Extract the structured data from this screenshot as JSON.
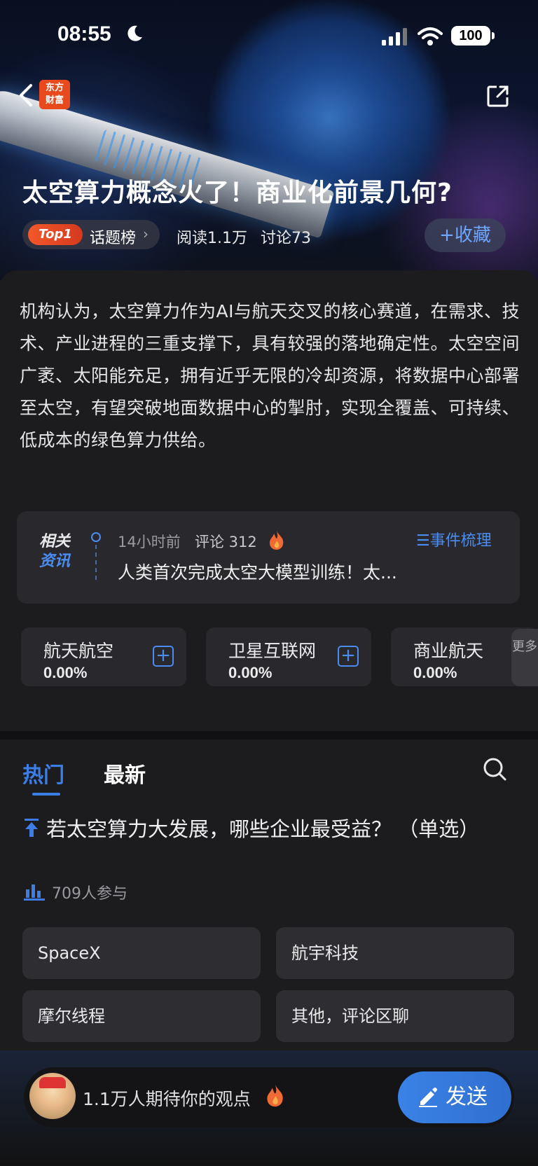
{
  "status_bar": {
    "time": "08:55",
    "battery": "100"
  },
  "nav": {
    "logo_line1": "东方",
    "logo_line2": "财富"
  },
  "topic": {
    "title": "太空算力概念火了！商业化前景几何?",
    "rank_badge": "Top1",
    "rank_label": "话题榜",
    "reads": "阅读1.1万",
    "discussions": "讨论73",
    "collect_label": "+收藏"
  },
  "summary": "机构认为，太空算力作为AI与航天交叉的核心赛道，在需求、技术、产业进程的三重支撑下，具有较强的落地确定性。太空空间广袤、太阳能充足，拥有近乎无限的冷却资源，将数据中心部署至太空，有望突破地面数据中心的掣肘，实现全覆盖、可持续、低成本的绿色算力供给。",
  "related_news": {
    "badge_line1": "相关",
    "badge_line2": "资讯",
    "time": "14小时前",
    "comments": "评论 312",
    "events_link": "☰事件梳理",
    "headline": "人类首次完成太空大模型训练！太..."
  },
  "sectors": [
    {
      "name": "航天航空",
      "value": "0.00%"
    },
    {
      "name": "卫星互联网",
      "value": "0.00%"
    },
    {
      "name": "商业航天",
      "value": "0.00%"
    }
  ],
  "more_label": "更多",
  "tabs": {
    "hot": "热门",
    "latest": "最新"
  },
  "poll": {
    "question": "若太空算力大发展，哪些企业最受益？ （单选）",
    "participants": "709人参与",
    "options": [
      "SpaceX",
      "航宇科技",
      "摩尔线程",
      "其他，评论区聊"
    ]
  },
  "bottom": {
    "prompt": "1.1万人期待你的观点",
    "send_label": "发送"
  },
  "colors": {
    "accent": "#3c7ee6",
    "badge_red": "#e8491d",
    "background": "#1c1c1e"
  }
}
